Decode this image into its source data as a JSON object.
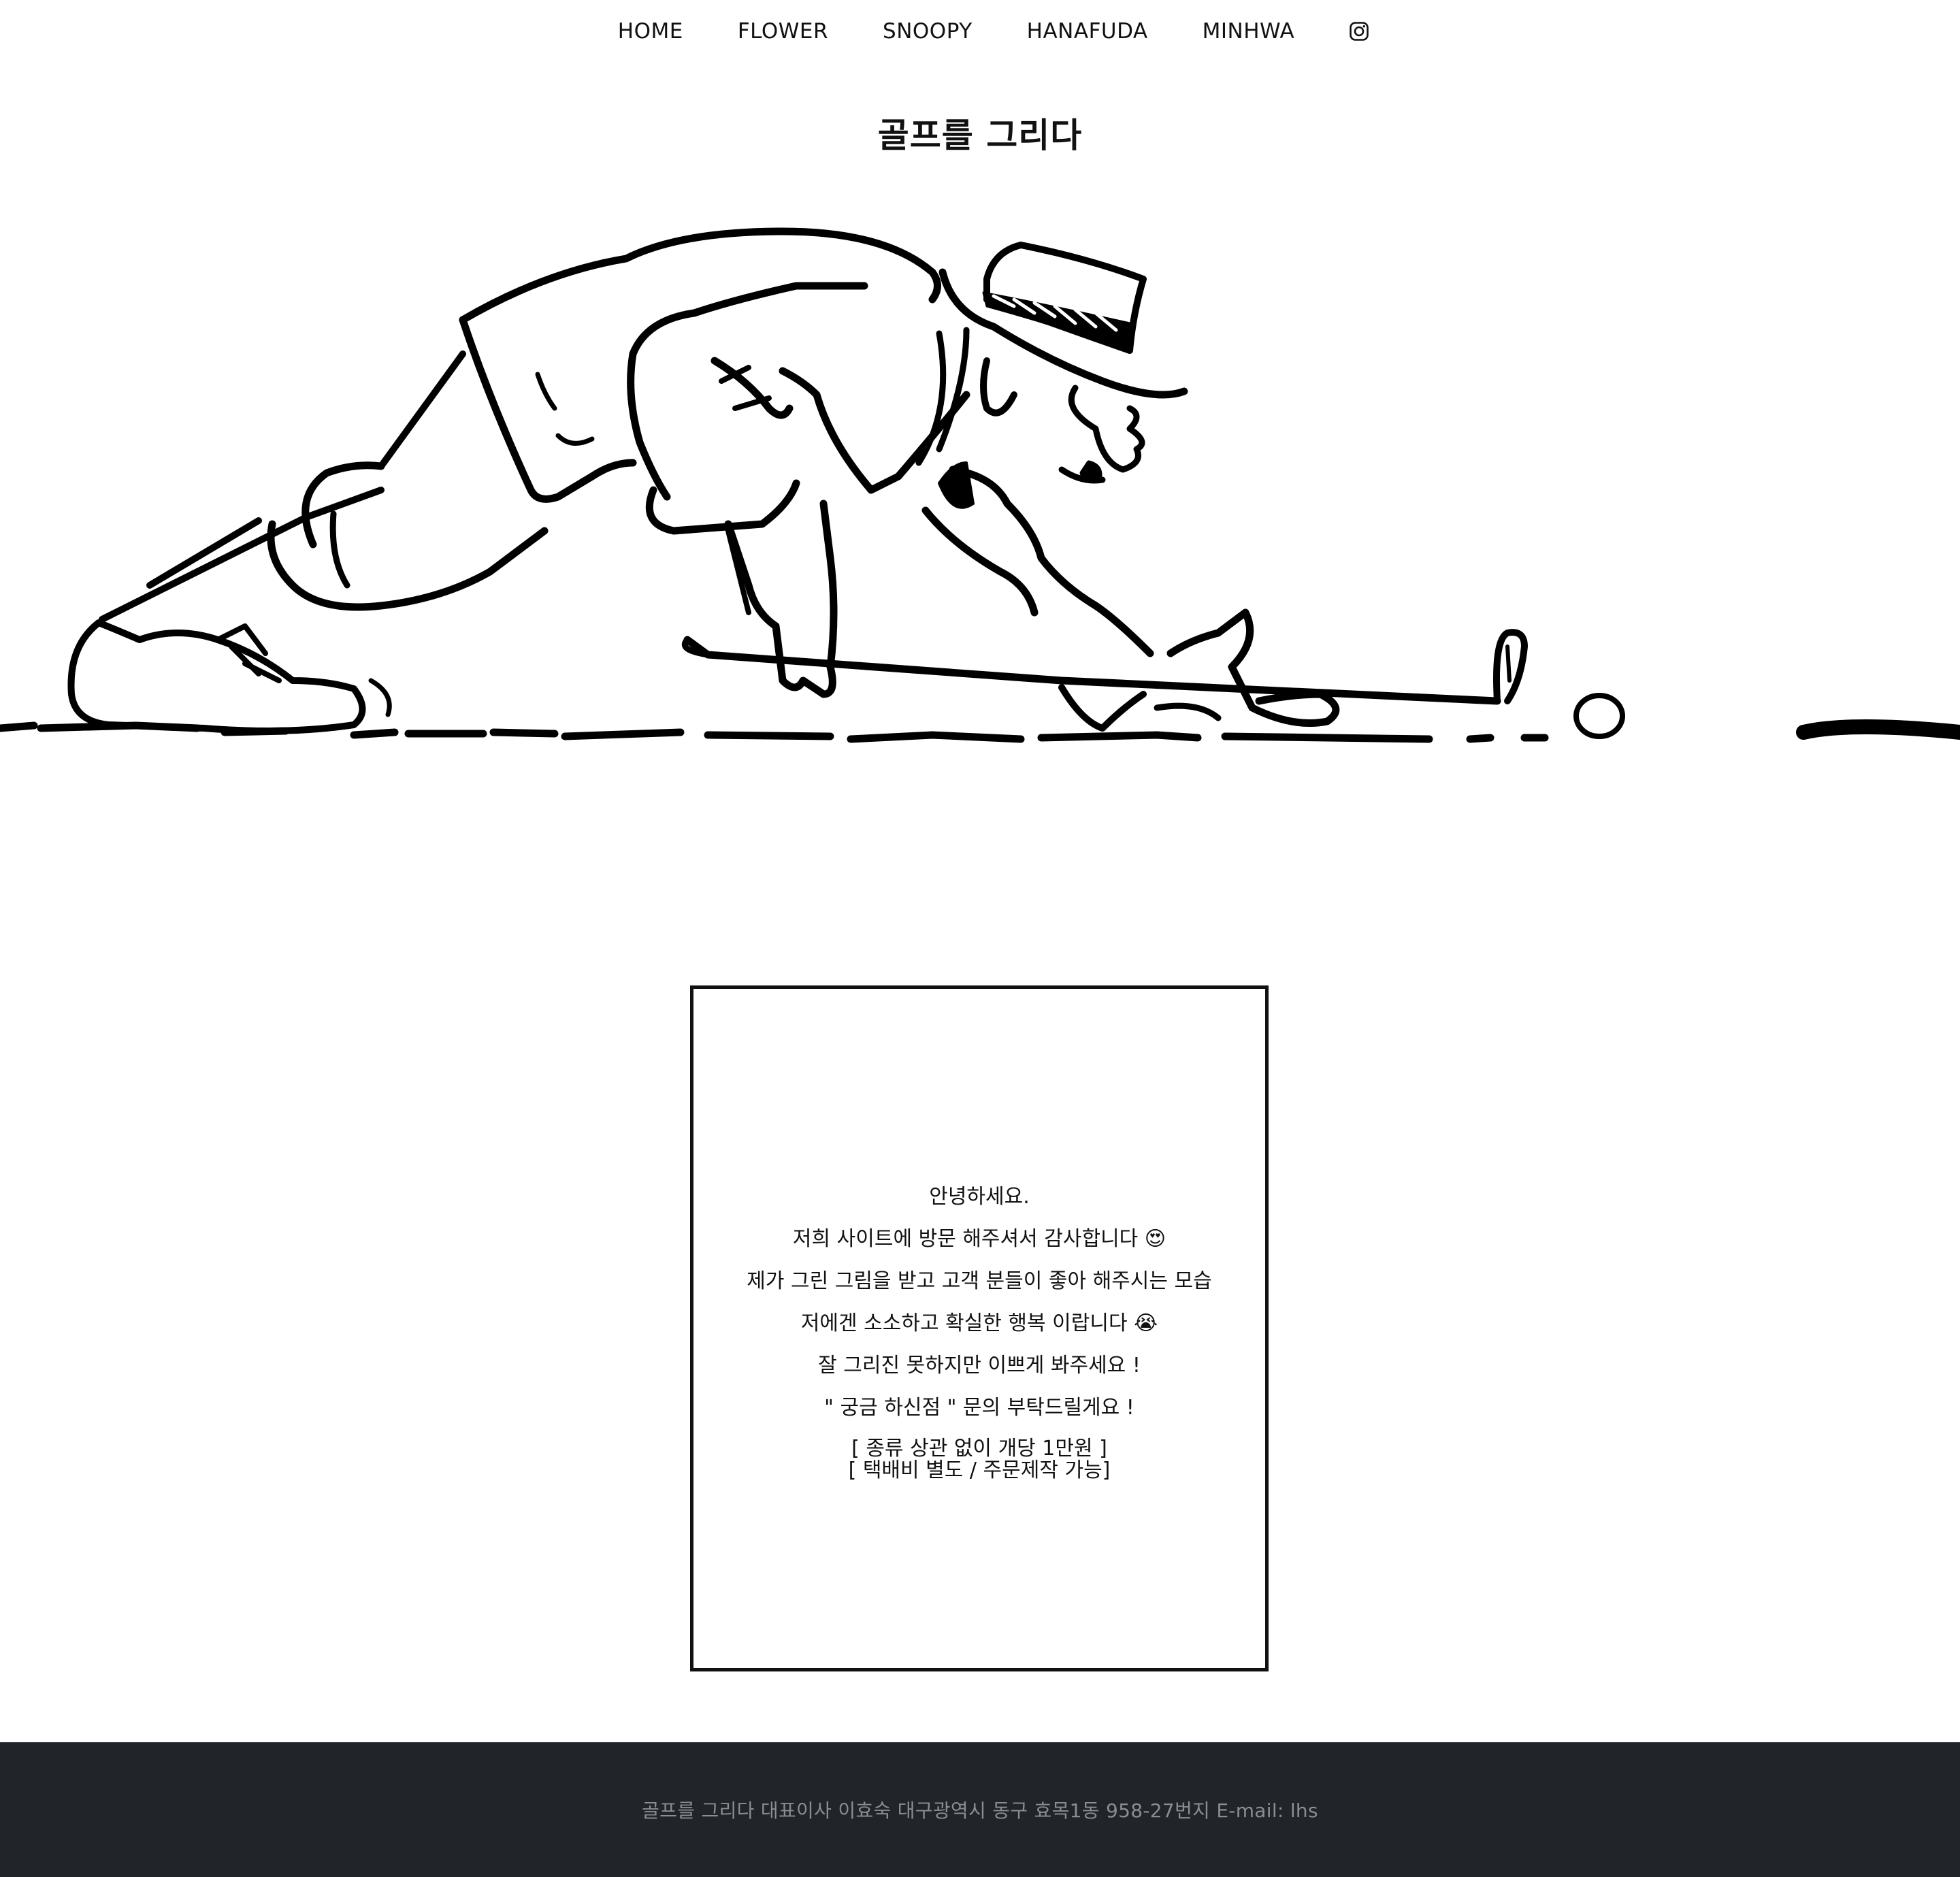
{
  "nav": {
    "items": [
      {
        "label": "HOME"
      },
      {
        "label": "FLOWER"
      },
      {
        "label": "SNOOPY"
      },
      {
        "label": "HANAFUDA"
      },
      {
        "label": "MINHWA"
      }
    ],
    "social_icon": "instagram-icon"
  },
  "site": {
    "title": "골프를 그리다"
  },
  "hero": {
    "image": "golfer-line-drawing"
  },
  "greeting": {
    "lines": [
      "안녕하세요.",
      "저희 사이트에 방문 해주셔서 감사합니다 😍",
      "제가 그린 그림을 받고 고객 분들이 좋아 해주시는 모습",
      "저에겐 소소하고 확실한 행복 이랍니다 😭",
      "잘 그리진 못하지만 이쁘게 봐주세요 !",
      "\" 궁금 하신점 \" 문의 부탁드릴게요 !"
    ],
    "price_line": "[ 종류 상관 없이 개당 1만원 ]",
    "shipping_line": "[ 택배비 별도 / 주문제작 가능]"
  },
  "footer": {
    "text": "골프를 그리다 대표이사 이효숙 대구광역시 동구 효목1동 958-27번지 E-mail: lhs",
    "background": "#212529"
  }
}
